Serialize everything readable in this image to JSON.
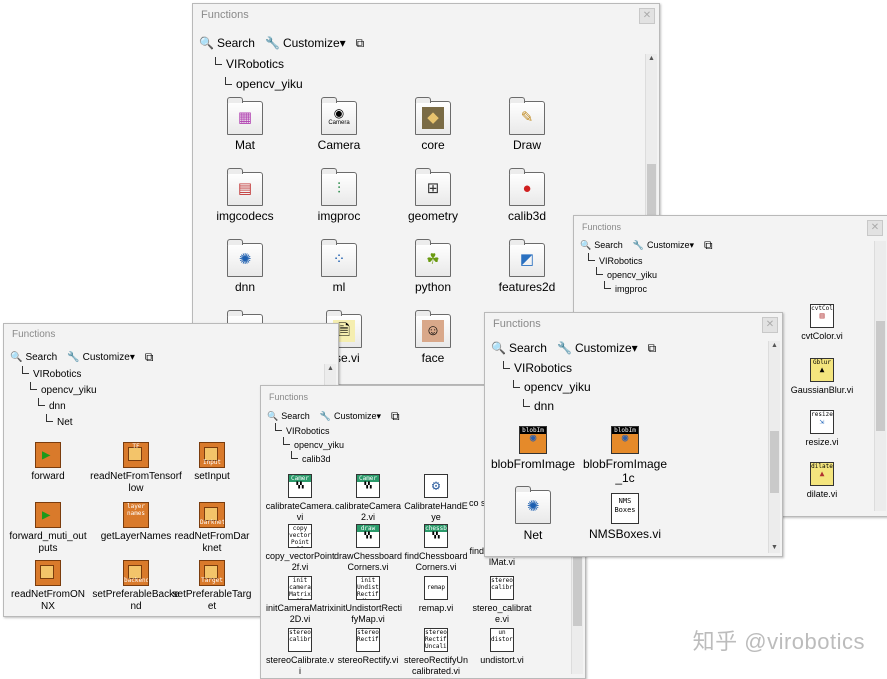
{
  "toolbar": {
    "search": "Search",
    "customize": "Customize▾"
  },
  "palettes": {
    "main": {
      "title": "Functions",
      "tree": [
        "VIRobotics",
        "opencv_yiku"
      ],
      "items": [
        {
          "label": "Mat",
          "icon": "mat-icon"
        },
        {
          "label": "Camera",
          "icon": "camera-icon"
        },
        {
          "label": "core",
          "icon": "core-chip-icon"
        },
        {
          "label": "Draw",
          "icon": "draw-icon"
        },
        {
          "label": "imgcodecs",
          "icon": "imgcodecs-icon"
        },
        {
          "label": "imgproc",
          "icon": "imgproc-icon"
        },
        {
          "label": "geometry",
          "icon": "geometry-icon"
        },
        {
          "label": "calib3d",
          "icon": "calib3d-icon"
        },
        {
          "label": "dnn",
          "icon": "dnn-network-icon"
        },
        {
          "label": "ml",
          "icon": "ml-scatter-icon"
        },
        {
          "label": "python",
          "icon": "python-icon"
        },
        {
          "label": "features2d",
          "icon": "features2d-icon"
        },
        {
          "label": "",
          "icon": "video-icon"
        },
        {
          "label": "ase.vi",
          "icon": "release-icon"
        },
        {
          "label": "face",
          "icon": "face-photo-icon"
        }
      ]
    },
    "imgproc": {
      "title": "Functions",
      "tree": [
        "VIRobotics",
        "opencv_yiku",
        "imgproc"
      ],
      "items": [
        {
          "label": "cvtColor.vi",
          "icon": "cvtcolor-icon"
        },
        {
          "label": "GaussianBlur.vi",
          "icon": "gaussianblur-icon"
        },
        {
          "label": "resize.vi",
          "icon": "resize-icon"
        },
        {
          "label": "dilate.vi",
          "icon": "dilate-icon"
        }
      ]
    },
    "dnn_net": {
      "title": "Functions",
      "tree": [
        "VIRobotics",
        "opencv_yiku",
        "dnn",
        "Net"
      ],
      "items": [
        {
          "label": "forward",
          "icon": "forward-icon"
        },
        {
          "label": "readNetFromTensorflow",
          "icon": "readnet-tf-icon"
        },
        {
          "label": "setInput",
          "icon": "setinput-icon"
        },
        {
          "label": "forward_muti_outputs",
          "icon": "forward-multi-icon"
        },
        {
          "label": "getLayerNames",
          "icon": "layer-names-icon"
        },
        {
          "label": "readNetFromDarknet",
          "icon": "readnet-darknet-icon"
        },
        {
          "label": "readNetFromONNX",
          "icon": "readnet-onnx-icon"
        },
        {
          "label": "setPreferableBackend",
          "icon": "backend-icon"
        },
        {
          "label": "setPreferableTarget",
          "icon": "target-icon"
        }
      ]
    },
    "calib3d": {
      "title": "Functions",
      "tree": [
        "VIRobotics",
        "opencv_yiku",
        "calib3d"
      ],
      "items": [
        {
          "label": "calibrateCamera.vi",
          "icon": "calibrate-camera-icon"
        },
        {
          "label": "calibrateCamera2.vi",
          "icon": "calibrate-camera2-icon"
        },
        {
          "label": "CalibrateHandEye",
          "icon": "hand-eye-icon"
        },
        {
          "label": "co sp",
          "icon": "partial-icon"
        },
        {
          "label": "copy_vectorPoint2f.vi",
          "icon": "copy-vector-icon"
        },
        {
          "label": "drawChessboardCorners.vi",
          "icon": "draw-chessboard-icon"
        },
        {
          "label": "findChessboardCorners.vi",
          "icon": "find-chessboard-icon"
        },
        {
          "label": "findFundamentalMat.vi",
          "icon": "fundamental-icon"
        },
        {
          "label": "initCameraMatrix2D.vi",
          "icon": "init-camera-icon"
        },
        {
          "label": "initUndistortRectifyMap.vi",
          "icon": "init-undistort-icon"
        },
        {
          "label": "remap.vi",
          "icon": "remap-icon"
        },
        {
          "label": "stereo_calibrate.vi",
          "icon": "stereo-calib-icon"
        },
        {
          "label": "stereoCalibrate.vi",
          "icon": "stereo-calibrate-icon"
        },
        {
          "label": "stereoRectify.vi",
          "icon": "stereo-rectify-icon"
        },
        {
          "label": "stereoRectifyUncalibrated.vi",
          "icon": "stereo-rect-uncal-icon"
        },
        {
          "label": "undistort.vi",
          "icon": "undistort-icon"
        }
      ]
    },
    "dnn": {
      "title": "Functions",
      "tree": [
        "VIRobotics",
        "opencv_yiku",
        "dnn"
      ],
      "items": [
        {
          "label": "blobFromImage",
          "icon": "blob-icon"
        },
        {
          "label": "blobFromImage_1c",
          "icon": "blob-1c-icon"
        },
        {
          "label": "Net",
          "icon": "net-icon"
        },
        {
          "label": "NMSBoxes.vi",
          "icon": "nms-boxes-icon"
        }
      ]
    }
  },
  "icon_text": {
    "camera": "Camera",
    "cvtcolor": "cvtCol",
    "gaussian": "Gblur",
    "resize": "resize",
    "dilate": "dilate",
    "tf": "TF",
    "input": "Input",
    "layer": "layer names",
    "darknet": "Darknet",
    "backend": "backend",
    "target": "Target",
    "cam1": "Camer",
    "cam2": "Camer",
    "copyvec": "copy vector Point 2f",
    "draw": "draw",
    "chess": "chessb",
    "initcam": "init camera Matrix 2D",
    "initund": "init Undist Rectify Map",
    "remap": "remap",
    "stereo": "stereo calibr",
    "stereorect": "stereo Rectify",
    "uncal": "stereo Rectify Uncalib",
    "undist": "un distort",
    "blob": "blobIm",
    "nms": "NMS Boxes"
  },
  "watermark": "知乎 @virobotics"
}
